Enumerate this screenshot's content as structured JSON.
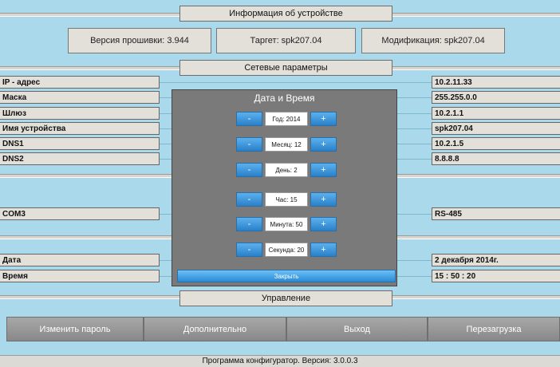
{
  "sections": {
    "device_info": "Информация об устройстве",
    "network": "Сетевые параметры",
    "control": "Управление"
  },
  "device": {
    "firmware": "Версия прошивки: 3.944",
    "target": "Таргет: spk207.04",
    "modification": "Модификация: spk207.04"
  },
  "params": [
    {
      "label": "IP - адрес",
      "value": "10.2.11.33"
    },
    {
      "label": "Маска",
      "value": "255.255.0.0"
    },
    {
      "label": "Шлюз",
      "value": "10.2.1.1"
    },
    {
      "label": "Имя устройства",
      "value": "spk207.04"
    },
    {
      "label": "DNS1",
      "value": "10.2.1.5"
    },
    {
      "label": "DNS2",
      "value": "8.8.8.8"
    }
  ],
  "com": {
    "label": "COM3",
    "value": "RS-485"
  },
  "datetime": {
    "date_label": "Дата",
    "date_value": "2 декабря 2014г.",
    "time_label": "Время",
    "time_value": "15 : 50 : 20"
  },
  "dialog": {
    "title": "Дата и Время",
    "minus": "-",
    "plus": "+",
    "rows": [
      "Год: 2014",
      "Месяц: 12",
      "День: 2",
      "Час: 15",
      "Минута: 50",
      "Секунда: 20"
    ],
    "close": "Закрыть"
  },
  "buttons": {
    "change_password": "Изменить пароль",
    "additional": "Дополнительно",
    "exit": "Выход",
    "reboot": "Перезагрузка"
  },
  "footer": "Программа конфигуратор. Версия: 3.0.0.3"
}
